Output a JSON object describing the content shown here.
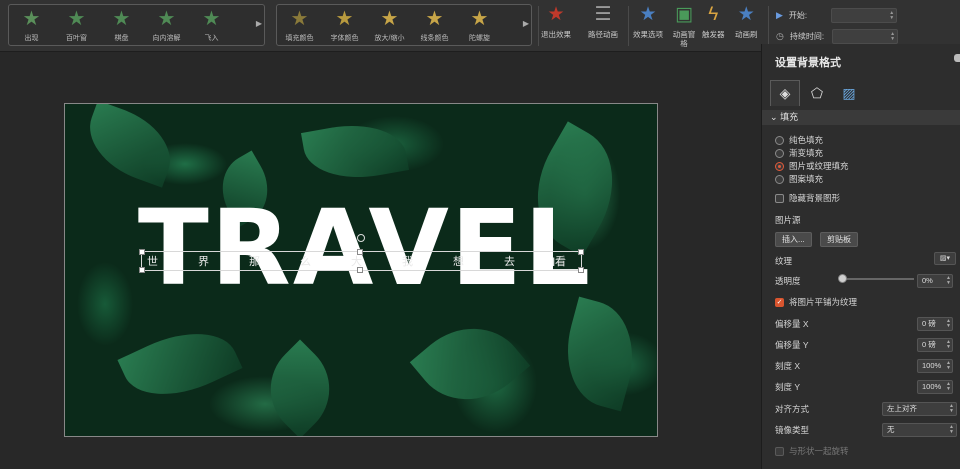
{
  "ribbon": {
    "entrance_gallery": [
      {
        "label": "出现",
        "color": "#5a8f5a"
      },
      {
        "label": "百叶窗",
        "color": "#4f8a55"
      },
      {
        "label": "棋盘",
        "color": "#4f8a55"
      },
      {
        "label": "向内溶解",
        "color": "#4f8a55"
      },
      {
        "label": "飞入",
        "color": "#4f8a55"
      }
    ],
    "emphasis_gallery": [
      {
        "label": "填充颜色",
        "color": "#8a7a3a"
      },
      {
        "label": "字体颜色",
        "color": "#b89a3e"
      },
      {
        "label": "放大/缩小",
        "color": "#c7a548"
      },
      {
        "label": "线条颜色",
        "color": "#c7a548"
      },
      {
        "label": "陀螺旋",
        "color": "#c7a548"
      }
    ],
    "buttons": [
      {
        "label": "退出效果",
        "icon": "star-exit-icon",
        "color": "#c0392b"
      },
      {
        "label": "路径动画",
        "icon": "path-icon",
        "color": "#aaaaaa"
      },
      {
        "label": "效果选项",
        "icon": "star-options-icon",
        "color": "#4a7fc1"
      },
      {
        "label": "动画窗格",
        "icon": "animation-pane-icon",
        "color": "#4a9a5a"
      },
      {
        "label": "触发器",
        "icon": "lightning-icon",
        "color": "#d9a441"
      },
      {
        "label": "动画刷",
        "icon": "brush-star-icon",
        "color": "#4a7fc1"
      }
    ],
    "timing": {
      "start_label": "开始:",
      "duration_label": "持续时间:"
    }
  },
  "slide": {
    "title": "TRAVEL",
    "subtitle_chars": [
      "世",
      "界",
      "那",
      "么",
      "大",
      "我",
      "想",
      "去",
      "看"
    ]
  },
  "panel": {
    "title": "设置背景格式",
    "section_fill": "填充",
    "fill_options": [
      {
        "label": "纯色填充",
        "selected": false
      },
      {
        "label": "渐变填充",
        "selected": false
      },
      {
        "label": "图片或纹理填充",
        "selected": true
      },
      {
        "label": "图案填充",
        "selected": false
      }
    ],
    "hide_bg_graphics": "隐藏背景图形",
    "picture_source": "图片源",
    "insert_btn": "插入...",
    "clipboard_btn": "剪贴板",
    "texture_label": "纹理",
    "transparency_label": "透明度",
    "transparency_value": "0%",
    "transparency_fraction": 0,
    "tile_label": "将图片平铺为纹理",
    "tile_checked": true,
    "offset_x_label": "偏移量 X",
    "offset_x_value": "0 磅",
    "offset_y_label": "偏移量 Y",
    "offset_y_value": "0 磅",
    "scale_x_label": "刻度 X",
    "scale_x_value": "100%",
    "scale_y_label": "刻度 Y",
    "scale_y_value": "100%",
    "align_label": "对齐方式",
    "align_value": "左上对齐",
    "mirror_label": "镜像类型",
    "mirror_value": "无",
    "rotate_with_shape": "与形状一起旋转"
  }
}
